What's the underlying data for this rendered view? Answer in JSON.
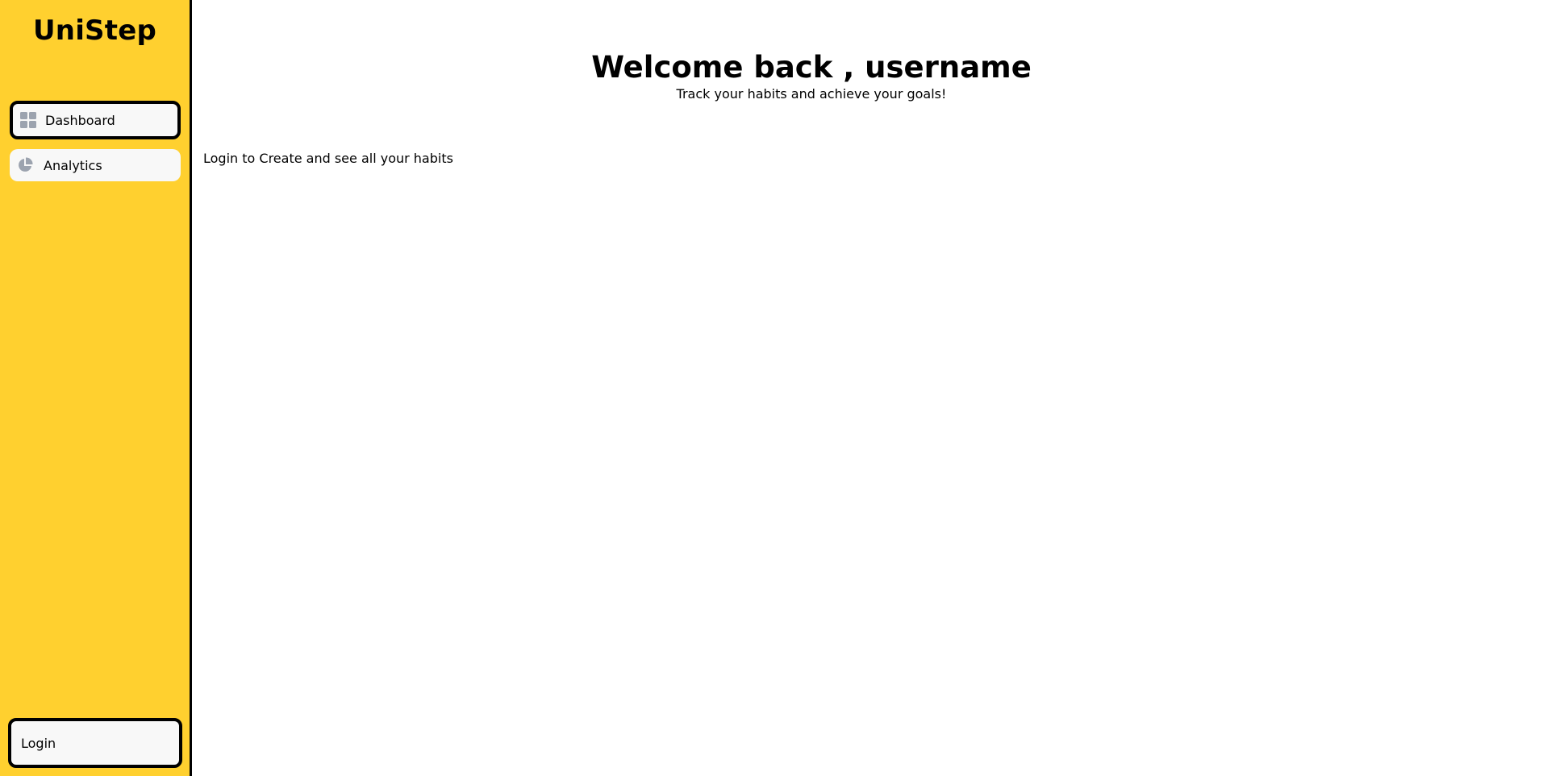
{
  "sidebar": {
    "brand": "UniStep",
    "items": [
      {
        "label": "Dashboard",
        "icon": "dashboard-grid-icon",
        "active": true
      },
      {
        "label": "Analytics",
        "icon": "pie-chart-icon",
        "active": false
      }
    ],
    "login_label": "Login"
  },
  "main": {
    "title": "Welcome back , username",
    "subtitle": "Track your habits and achieve your goals!",
    "login_prompt": "Login to Create and see all your habits"
  },
  "colors": {
    "sidebar_bg": "#FFD02F",
    "icon_gray": "#9ca3af",
    "button_bg": "#f8f8f8"
  }
}
